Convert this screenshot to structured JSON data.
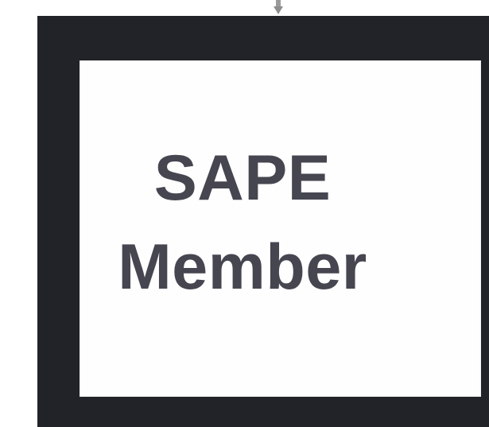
{
  "sign": {
    "line1": "SAPE",
    "line2": "Member"
  },
  "colors": {
    "frame": "#222328",
    "mat": "#fefefe",
    "text": "#454650",
    "hanger": "#8e8e8e"
  },
  "icons": {
    "hanger": "hanging-hook-icon"
  }
}
